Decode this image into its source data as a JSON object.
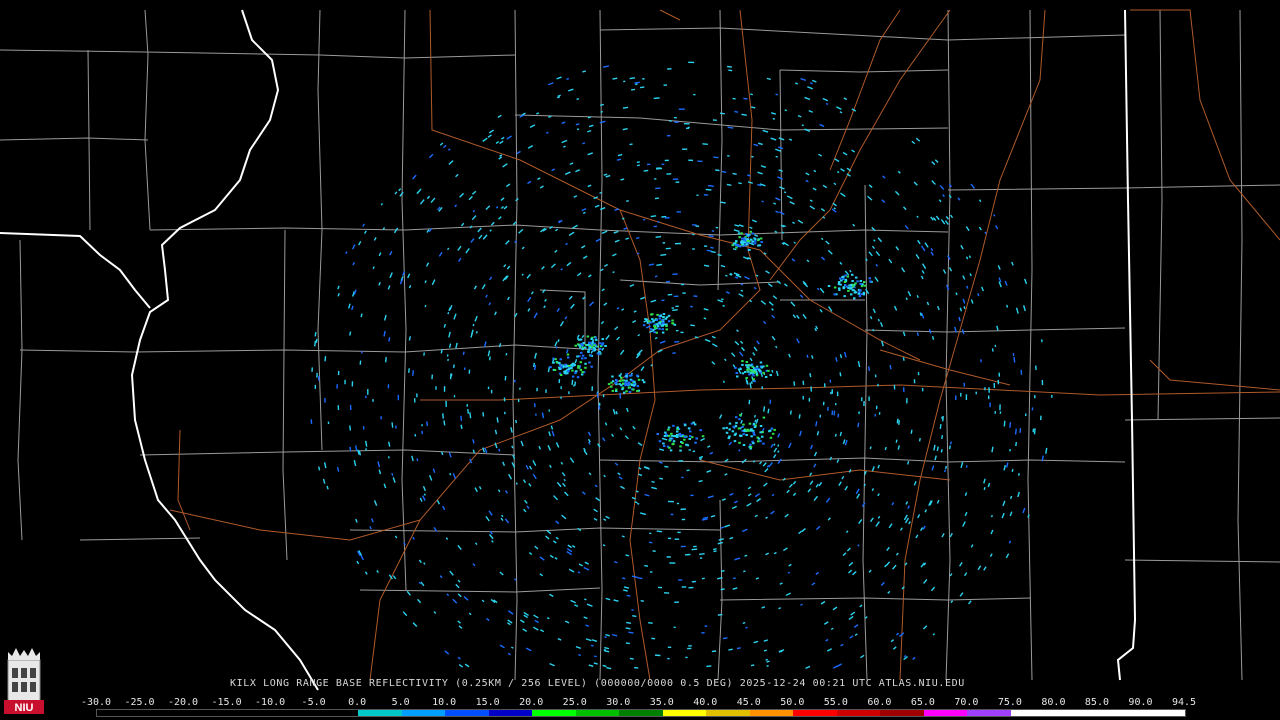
{
  "product": {
    "caption": "KILX LONG RANGE BASE REFLECTIVITY (0.25KM / 256 LEVEL) (000000/0000 0.5 DEG) 2025-12-24 00:21 UTC  ATLAS.NIU.EDU",
    "logo_text": "NIU"
  },
  "scale": {
    "ticks": [
      "-30.0",
      "-25.0",
      "-20.0",
      "-15.0",
      "-10.0",
      "-5.0",
      "0.0",
      "5.0",
      "10.0",
      "15.0",
      "20.0",
      "25.0",
      "30.0",
      "35.0",
      "40.0",
      "45.0",
      "50.0",
      "55.0",
      "60.0",
      "65.0",
      "70.0",
      "75.0",
      "80.0",
      "85.0",
      "90.0",
      "94.5"
    ],
    "colors": [
      "#000000",
      "#000000",
      "#000000",
      "#000000",
      "#000000",
      "#000000",
      "#00c8c8",
      "#00a0ff",
      "#0050ff",
      "#0000c8",
      "#00ff00",
      "#00c000",
      "#008000",
      "#ffff00",
      "#e0c000",
      "#ff9000",
      "#ff0000",
      "#d00000",
      "#a00000",
      "#ff00ff",
      "#a040ff",
      "#ffffff",
      "#ffffff",
      "#ffffff",
      "#ffffff"
    ]
  },
  "map_colors": {
    "state_border": "#ffffff",
    "county_border": "#9a9a9a",
    "highway": "#b05a2a",
    "echo_light": "#2ad4f0",
    "echo_medium": "#1a6cff",
    "echo_heavy": "#2ee04a"
  }
}
